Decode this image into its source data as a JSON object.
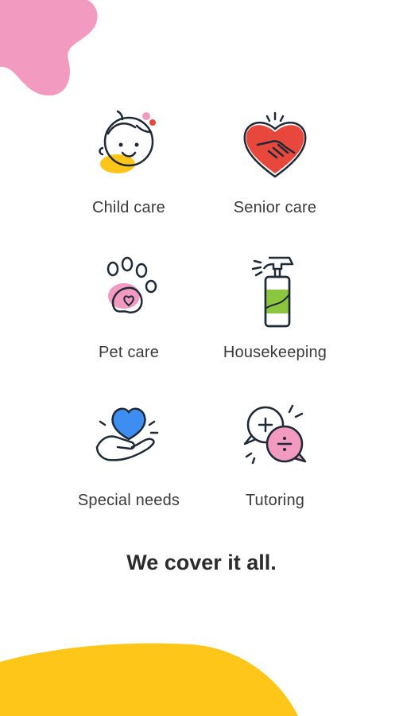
{
  "services": [
    {
      "label": "Child care",
      "icon": "child-face-icon"
    },
    {
      "label": "Senior care",
      "icon": "heart-handshake-icon"
    },
    {
      "label": "Pet care",
      "icon": "paw-print-icon"
    },
    {
      "label": "Housekeeping",
      "icon": "spray-bottle-icon"
    },
    {
      "label": "Special needs",
      "icon": "hand-heart-icon"
    },
    {
      "label": "Tutoring",
      "icon": "math-speech-bubbles-icon"
    }
  ],
  "tagline": "We cover it all.",
  "colors": {
    "pink": "#F29AC0",
    "yellow": "#FFC61A",
    "red": "#E8473C",
    "green": "#8CC63F",
    "blue": "#3D8EF0",
    "ink": "#1f2a36"
  }
}
